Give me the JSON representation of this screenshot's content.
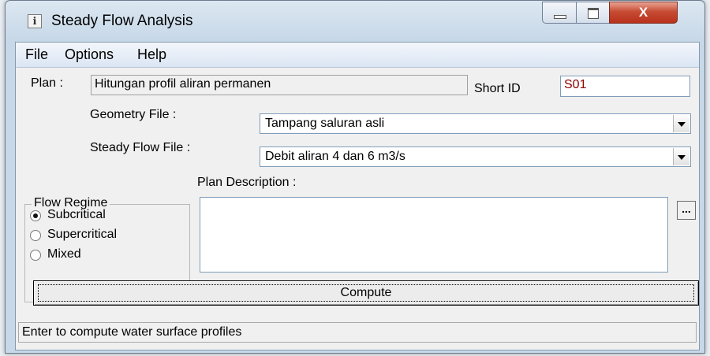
{
  "window": {
    "title": "Steady Flow Analysis",
    "close_glyph": "X",
    "app_icon_glyph": "ℹ"
  },
  "menu": {
    "items": [
      "File",
      "Options",
      "Help"
    ]
  },
  "plan": {
    "label": "Plan :",
    "value": "Hitungan profil aliran permanen"
  },
  "short_id": {
    "label": "Short ID",
    "value": "S01"
  },
  "geometry": {
    "label": "Geometry File :",
    "value": "Tampang saluran asli"
  },
  "steady_flow": {
    "label": "Steady Flow File :",
    "value": "Debit aliran 4 dan 6 m3/s"
  },
  "flow_regime": {
    "title": "Flow Regime",
    "options": [
      {
        "label": "Subcritical",
        "checked": true
      },
      {
        "label": "Supercritical",
        "checked": false
      },
      {
        "label": "Mixed",
        "checked": false
      }
    ]
  },
  "plan_description": {
    "label": "Plan Description :",
    "value": "",
    "browse_label": "..."
  },
  "compute": {
    "label": "Compute"
  },
  "status": {
    "text": "Enter to compute water surface profiles"
  },
  "colors": {
    "short_id_text": "#8b0000",
    "close_button": "#c74b33"
  }
}
